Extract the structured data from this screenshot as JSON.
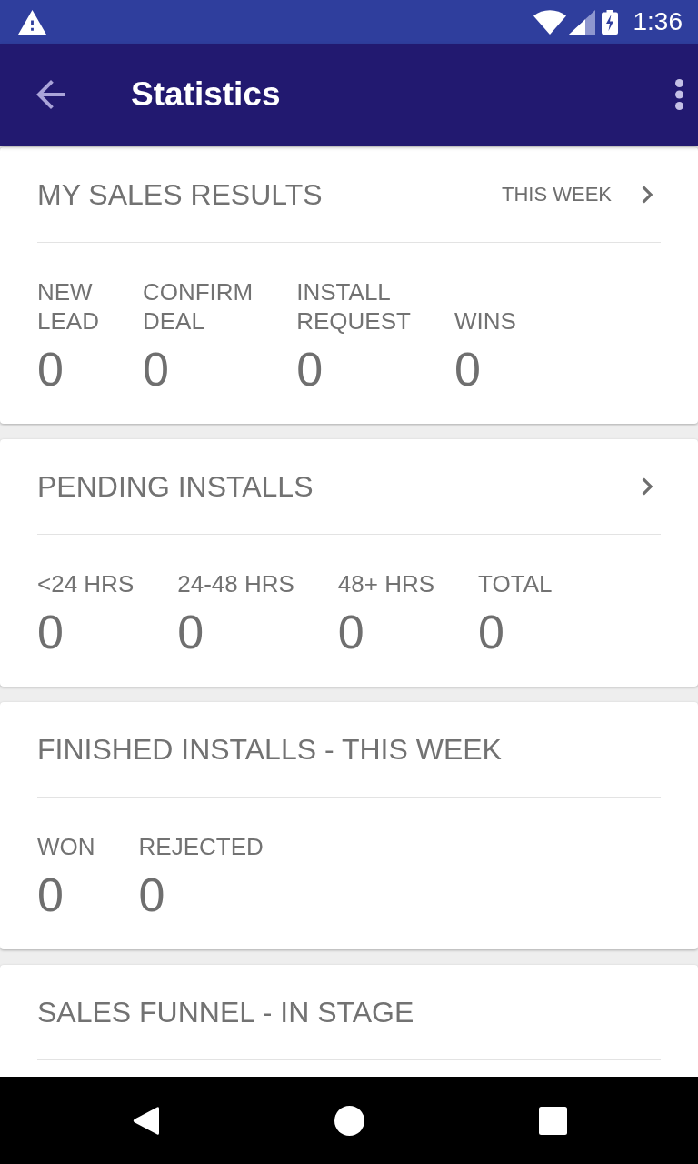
{
  "status_bar": {
    "time": "1:36"
  },
  "app_bar": {
    "title": "Statistics"
  },
  "cards": [
    {
      "title": "MY SALES RESULTS",
      "period": "THIS WEEK",
      "link": true,
      "stats": [
        {
          "label": "NEW\nLEAD",
          "value": "0"
        },
        {
          "label": "CONFIRM\nDEAL",
          "value": "0"
        },
        {
          "label": "INSTALL\nREQUEST",
          "value": "0"
        },
        {
          "label": "WINS",
          "value": "0"
        }
      ]
    },
    {
      "title": "PENDING INSTALLS",
      "link": true,
      "stats": [
        {
          "label": "<24 HRS",
          "value": "0"
        },
        {
          "label": "24-48 HRS",
          "value": "0"
        },
        {
          "label": "48+ HRS",
          "value": "0"
        },
        {
          "label": "TOTAL",
          "value": "0"
        }
      ]
    },
    {
      "title": "FINISHED INSTALLS - THIS WEEK",
      "link": false,
      "stats": [
        {
          "label": "WON",
          "value": "0"
        },
        {
          "label": "REJECTED",
          "value": "0"
        }
      ]
    },
    {
      "title": "SALES FUNNEL - IN STAGE",
      "link": false
    }
  ]
}
